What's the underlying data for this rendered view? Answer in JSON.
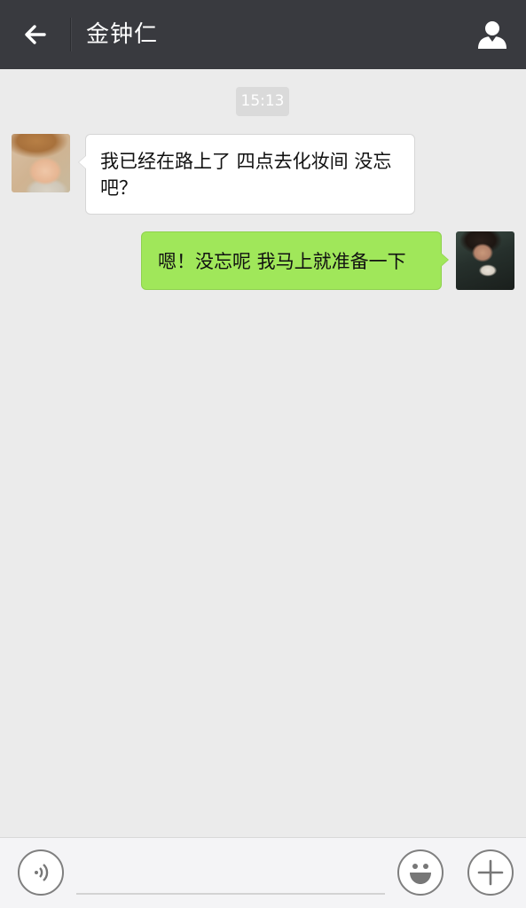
{
  "header": {
    "title": "金钟仁",
    "back_icon": "arrow-left-icon",
    "contact_icon": "person-icon",
    "background": "#393a3f"
  },
  "chat": {
    "timestamp": "15:13",
    "messages": [
      {
        "side": "left",
        "text": "我已经在路上了 四点去化妆间 没忘吧？",
        "avatar": "contact-avatar"
      },
      {
        "side": "right",
        "text": "嗯！没忘呢 我马上就准备一下",
        "avatar": "my-avatar"
      }
    ],
    "colors": {
      "incoming_bubble": "#ffffff",
      "outgoing_bubble": "#a0e75a",
      "background": "#ebebeb"
    }
  },
  "input_bar": {
    "voice_icon": "voice-icon",
    "emoji_icon": "smiley-icon",
    "plus_icon": "plus-icon",
    "message_value": "",
    "message_placeholder": ""
  }
}
